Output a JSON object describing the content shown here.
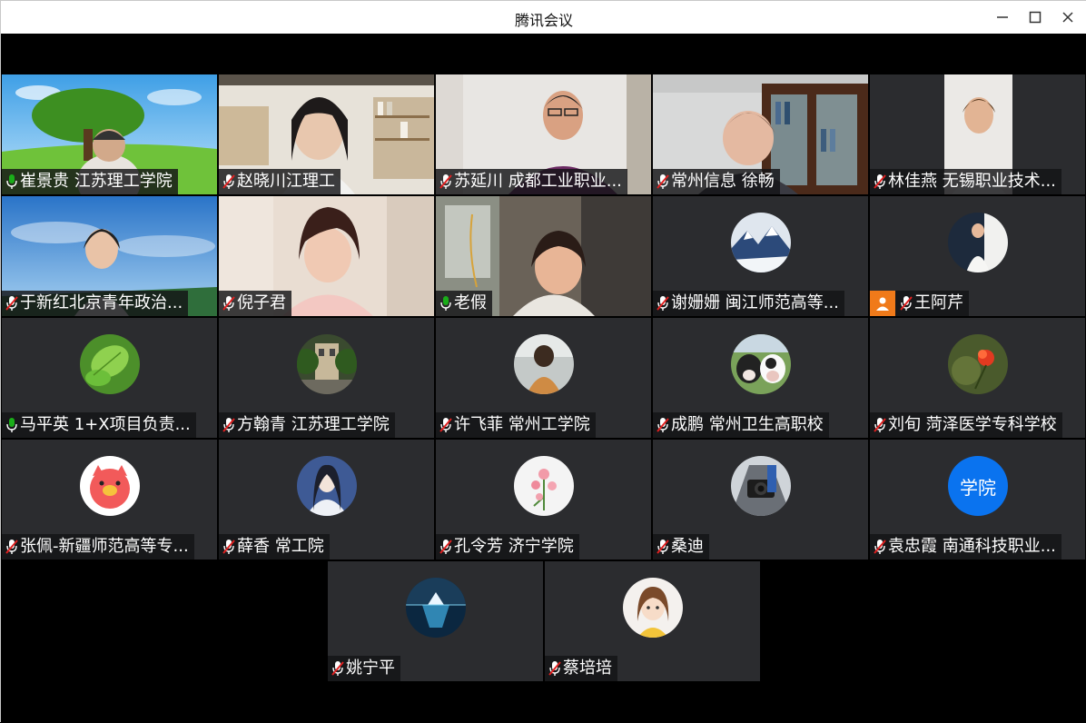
{
  "window": {
    "title": "腾讯会议",
    "controls": [
      "minimize-icon",
      "maximize-icon",
      "close-icon"
    ]
  },
  "colors": {
    "tile_bg": "#2b2c2f",
    "name_bg": "#141416",
    "mic_on": "#1aad19",
    "mic_muted": "#e02020",
    "active_border": "#1aad19",
    "host_badge": "#f07a1a",
    "avatar_text_bg": "#0a73ef"
  },
  "participants": [
    {
      "name": "崔景贵  江苏理工学院",
      "mic": "on",
      "display": "video",
      "scene": "tree-landscape"
    },
    {
      "name": "赵晓川江理工",
      "mic": "muted",
      "display": "video",
      "scene": "bookshelf-room"
    },
    {
      "name": "苏延川 成都工业职业...",
      "mic": "muted",
      "display": "video",
      "scene": "office-wall"
    },
    {
      "name": "常州信息  徐畅",
      "mic": "muted",
      "display": "video",
      "scene": "bookcase-office"
    },
    {
      "name": "林佳燕 无锡职业技术...",
      "mic": "muted",
      "display": "video",
      "scene": "light-wall"
    },
    {
      "name": "于新红北京青年政治...",
      "mic": "muted",
      "display": "video",
      "scene": "blue-sky"
    },
    {
      "name": "倪子君",
      "mic": "muted",
      "display": "video",
      "scene": "warm-room"
    },
    {
      "name": "老假",
      "mic": "on",
      "display": "video",
      "scene": "window-room",
      "active": true
    },
    {
      "name": "谢姗姗 闽江师范高等...",
      "mic": "muted",
      "display": "avatar",
      "avatar": "snow-mountain-avatar"
    },
    {
      "name": "王阿芹",
      "mic": "muted",
      "display": "avatar",
      "avatar": "person-photo-avatar",
      "host": true
    },
    {
      "name": "马平英  1+X项目负责...",
      "mic": "on",
      "display": "avatar",
      "avatar": "green-leaf-avatar"
    },
    {
      "name": "方翰青 江苏理工学院",
      "mic": "muted",
      "display": "avatar",
      "avatar": "garden-building-avatar"
    },
    {
      "name": "许飞菲 常州工学院",
      "mic": "muted",
      "display": "avatar",
      "avatar": "back-view-person-avatar"
    },
    {
      "name": "成鹏 常州卫生高职校",
      "mic": "muted",
      "display": "avatar",
      "avatar": "cows-avatar"
    },
    {
      "name": "刘旬 菏泽医学专科学校",
      "mic": "muted",
      "display": "avatar",
      "avatar": "red-flower-avatar"
    },
    {
      "name": "张佩-新疆师范高等专...",
      "mic": "muted",
      "display": "avatar",
      "avatar": "cartoon-pig-avatar"
    },
    {
      "name": "薛香 常工院",
      "mic": "muted",
      "display": "avatar",
      "avatar": "anime-girl-avatar"
    },
    {
      "name": "孔令芳 济宁学院",
      "mic": "muted",
      "display": "avatar",
      "avatar": "pink-flowers-avatar"
    },
    {
      "name": "桑迪",
      "mic": "muted",
      "display": "avatar",
      "avatar": "camera-avatar"
    },
    {
      "name": "袁忠霞 南通科技职业...",
      "mic": "muted",
      "display": "avatar",
      "avatar": "text-avatar",
      "avatar_text": "学院"
    },
    {
      "name": "姚宁平",
      "mic": "muted",
      "display": "avatar",
      "avatar": "iceberg-avatar"
    },
    {
      "name": "蔡培培",
      "mic": "muted",
      "display": "avatar",
      "avatar": "cartoon-girl-avatar"
    }
  ]
}
